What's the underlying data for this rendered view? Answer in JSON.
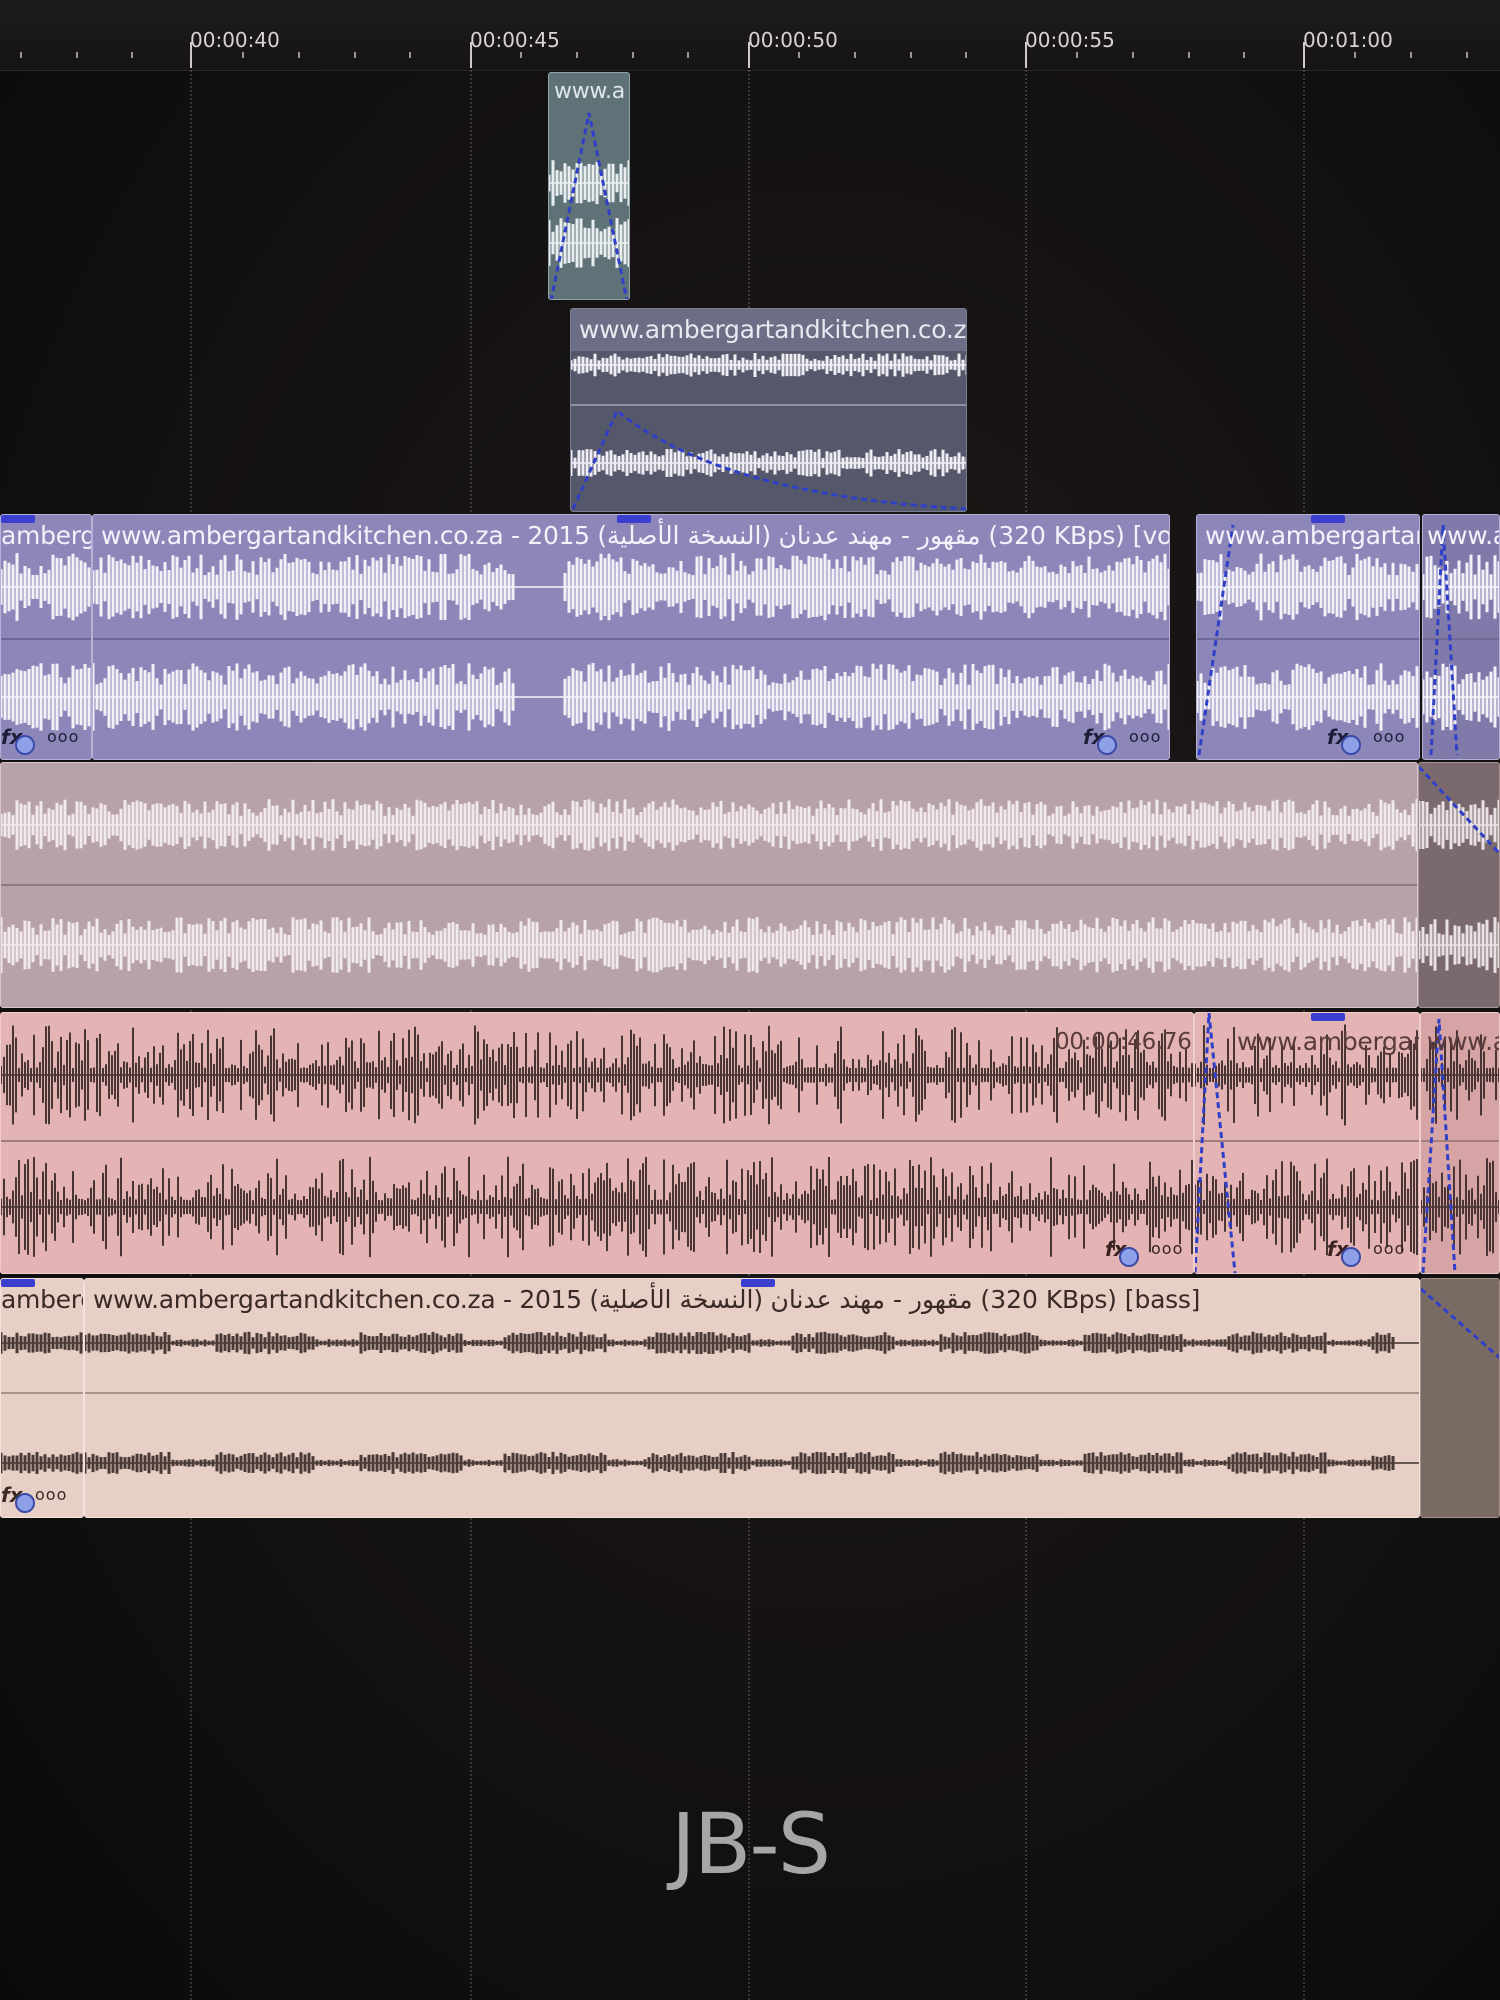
{
  "ruler": {
    "ticks": [
      "00:00:40",
      "00:00:45",
      "00:00:50",
      "00:00:55",
      "00:01:00"
    ]
  },
  "tracks": {
    "fx_clip_a": {
      "title": "www.a"
    },
    "fx_clip_b": {
      "title": "www.ambergartandkitchen.co.za -"
    },
    "vocals": {
      "left_title": "amberg",
      "main_title": "www.ambergartandkitchen.co.za - 2015 (النسخة الأصلية) مقهور - مهند عدنان (320 KBps) [vocals",
      "right_title": "www.ambergartan",
      "edge_title": "www.a"
    },
    "drums": {
      "timestamp": "00:00:46.76",
      "right_title": "www.ambergartan",
      "edge_title": "www.a"
    },
    "bass": {
      "left_title": "amberg",
      "main_title": "www.ambergartandkitchen.co.za - 2015 (النسخة الأصلية) مقهور - مهند عدنان (320 KBps) [bass]"
    }
  },
  "icons": {
    "fx": "fx-icon",
    "more": "more-options-icon"
  },
  "labels": {
    "fx_text": "fx",
    "more_text": "ooo"
  },
  "brand": "JB-S",
  "colors": {
    "background": "#141111",
    "vocals_clip": "#8c87b8",
    "mix_clip": "#b8a2aa",
    "drums_clip": "#e4b4b4",
    "bass_clip": "#e7cfc6",
    "envelope": "#2f3fc8"
  }
}
